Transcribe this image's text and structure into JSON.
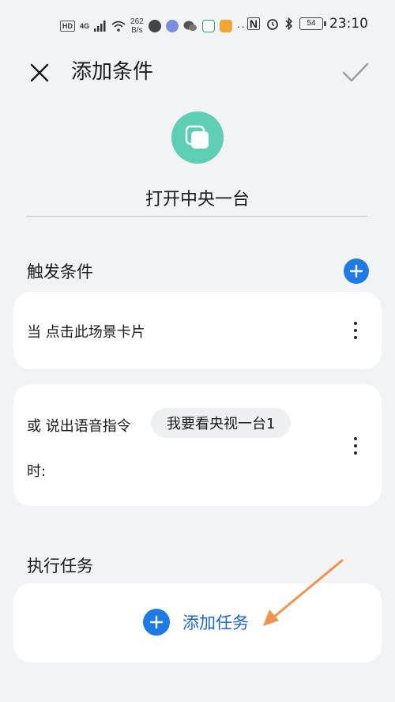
{
  "status_bar": {
    "hd": "HD",
    "network": "4G",
    "speed_value": "262",
    "speed_unit": "B/s",
    "battery": "54",
    "time": "23:10"
  },
  "header": {
    "title": "添加条件",
    "close_icon": "close-icon",
    "confirm_icon": "check-icon"
  },
  "scene": {
    "icon": "layers-icon",
    "icon_color": "#5fcfb4",
    "name": "打开中央一台"
  },
  "trigger_section": {
    "title": "触发条件",
    "conditions": [
      {
        "text": "当 点击此场景卡片"
      },
      {
        "prefix": "或 说出语音指令",
        "voice_command": "我要看央视一台1",
        "suffix": "时:"
      }
    ]
  },
  "task_section": {
    "title": "执行任务",
    "add_label": "添加任务"
  },
  "colors": {
    "accent": "#1f7ae6",
    "link": "#1f66c9",
    "annotation_arrow": "#ee9350",
    "background": "#f1f3f5"
  }
}
